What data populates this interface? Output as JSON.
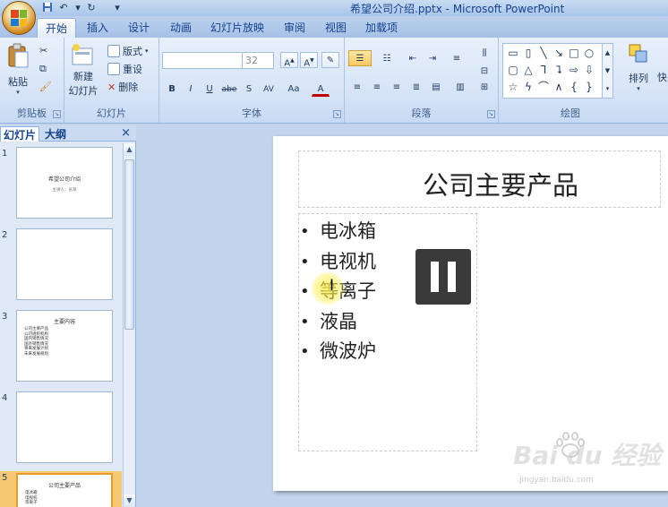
{
  "window": {
    "title": "希望公司介绍.pptx - Microsoft PowerPoint"
  },
  "quick_access": {
    "icons": [
      "save-icon",
      "undo-icon",
      "redo-icon",
      "customize-icon"
    ]
  },
  "tabs": [
    {
      "label": "开始",
      "active": true
    },
    {
      "label": "插入"
    },
    {
      "label": "设计"
    },
    {
      "label": "动画"
    },
    {
      "label": "幻灯片放映"
    },
    {
      "label": "审阅"
    },
    {
      "label": "视图"
    },
    {
      "label": "加载项"
    }
  ],
  "ribbon": {
    "clipboard": {
      "label": "剪贴板",
      "paste": "粘贴"
    },
    "slides": {
      "label": "幻灯片",
      "new_slide_1": "新建",
      "new_slide_2": "幻灯片",
      "layout": "版式",
      "reset": "重设",
      "delete": "删除"
    },
    "font": {
      "label": "字体",
      "font_name": "",
      "font_size": "32",
      "bold": "B",
      "italic": "I",
      "underline": "U",
      "strike": "abe",
      "shadow": "S",
      "spacing": "AV",
      "case": "Aa",
      "color": "A"
    },
    "paragraph": {
      "label": "段落"
    },
    "drawing": {
      "label": "绘图",
      "arrange": "排列",
      "quick_styles": "快"
    }
  },
  "left_pane": {
    "tab_slides": "幻灯片",
    "tab_outline": "大纲",
    "close": "×",
    "thumbnails": [
      {
        "num": "1",
        "title": "希望公司介绍",
        "sub": "主讲人：张某"
      },
      {
        "num": "2"
      },
      {
        "num": "3",
        "title": "主要内容",
        "items": [
          "公司主要产品",
          "公司组织机构",
          "国内销售情况",
          "国外销售情况",
          "将来发展计划",
          "未来发展规划"
        ]
      },
      {
        "num": "4"
      },
      {
        "num": "5",
        "title": "公司主要产品",
        "items": [
          "电冰箱",
          "电视机",
          "等离子"
        ],
        "selected": true
      }
    ]
  },
  "slide": {
    "title": "公司主要产品",
    "bullets": [
      "电冰箱",
      "电视机",
      "等离子",
      "液晶",
      "微波炉"
    ]
  },
  "watermark": {
    "brand": "Bai du 经验",
    "url": "jingyan.baidu.com"
  },
  "colors": {
    "accent": "#15428b",
    "ribbon_bg": "#dae6f6",
    "selected_thumb": "#f7c873"
  }
}
